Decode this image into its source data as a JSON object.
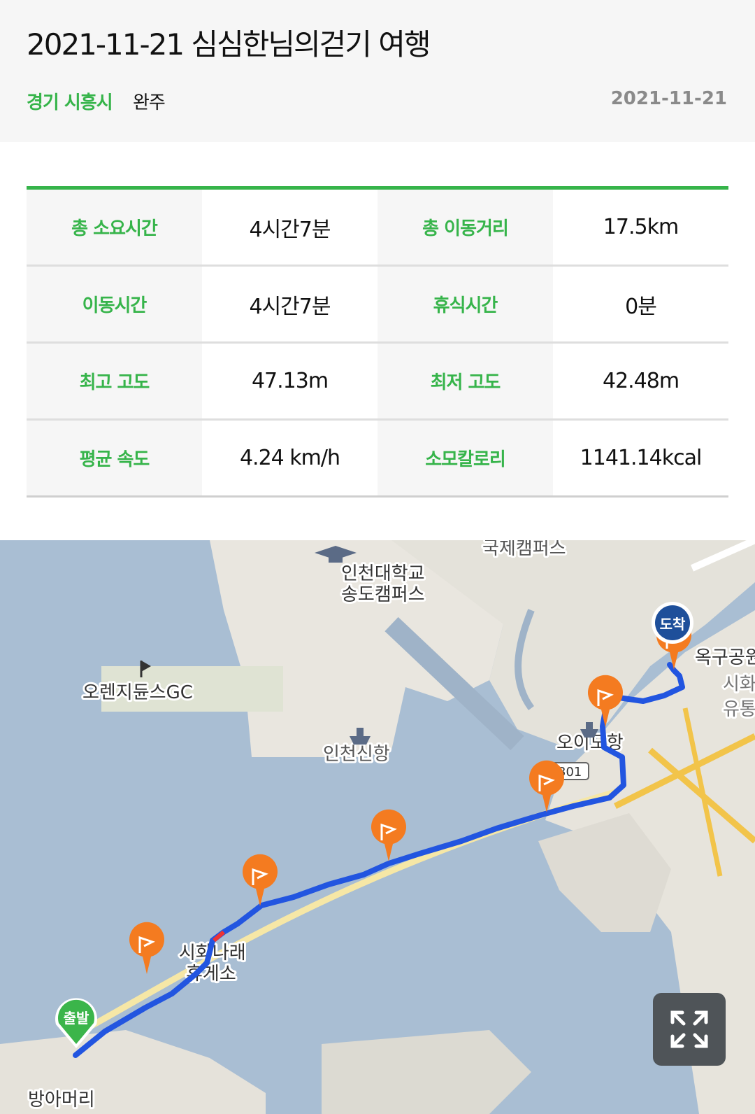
{
  "header": {
    "title": "2021-11-21 심심한님의걷기 여행",
    "region": "경기 시흥시",
    "status": "완주",
    "date": "2021-11-21"
  },
  "stats": {
    "rows": [
      [
        {
          "label": "총 소요시간",
          "value": "4시간7분"
        },
        {
          "label": "총 이동거리",
          "value": "17.5km"
        }
      ],
      [
        {
          "label": "이동시간",
          "value": "4시간7분"
        },
        {
          "label": "휴식시간",
          "value": "0분"
        }
      ],
      [
        {
          "label": "최고 고도",
          "value": "47.13m"
        },
        {
          "label": "최저 고도",
          "value": "42.48m"
        }
      ],
      [
        {
          "label": "평균 속도",
          "value": "4.24 km/h"
        },
        {
          "label": "소모칼로리",
          "value": "1141.14kcal"
        }
      ]
    ]
  },
  "map": {
    "places": [
      "인천대학교",
      "송도캠퍼스",
      "국제캠퍼스",
      "오렌지듄스GC",
      "인천신항",
      "오이도항",
      "옥구공원",
      "시화",
      "유통",
      "시화나래",
      "휴게소",
      "방아머리",
      "301"
    ],
    "markers": {
      "start_label": "출발",
      "end_label": "도착",
      "start_color": "#3bb54a",
      "end_color": "#1e4f9a",
      "checkpoint_color": "#f47b20",
      "route_color": "#2255e0"
    },
    "expand_icon": "expand-arrows-icon"
  }
}
